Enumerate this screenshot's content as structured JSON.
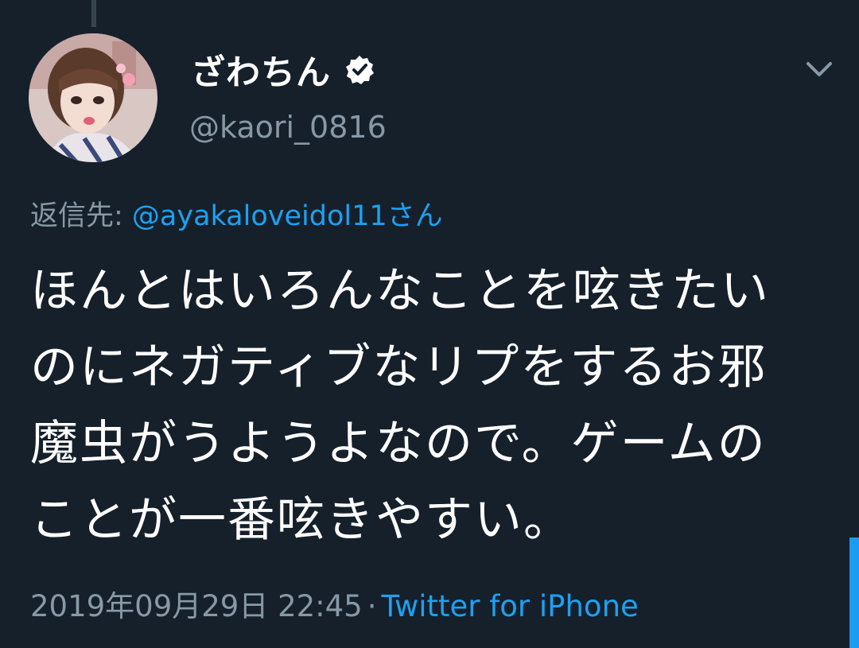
{
  "tweet": {
    "author": {
      "display_name": "ざわちん",
      "handle": "@kaori_0816",
      "verified_icon": "verified-badge-icon",
      "avatar": "avatar"
    },
    "reply_prefix": "返信先: ",
    "reply_to": "@ayakaloveidol11さん",
    "text_lines": [
      "ほんとはいろんなことを呟きたい",
      "のにネガティブなリプをするお邪",
      "魔虫がうようよなので。ゲームの",
      "ことが一番呟きやすい。"
    ],
    "timestamp": "2019年09月29日 22:45",
    "separator": "·",
    "source": "Twitter for iPhone",
    "menu_icon": "chevron-down-icon"
  },
  "colors": {
    "background": "#15202b",
    "text": "#ffffff",
    "secondary": "#8899a6",
    "accent": "#1da1f2"
  }
}
